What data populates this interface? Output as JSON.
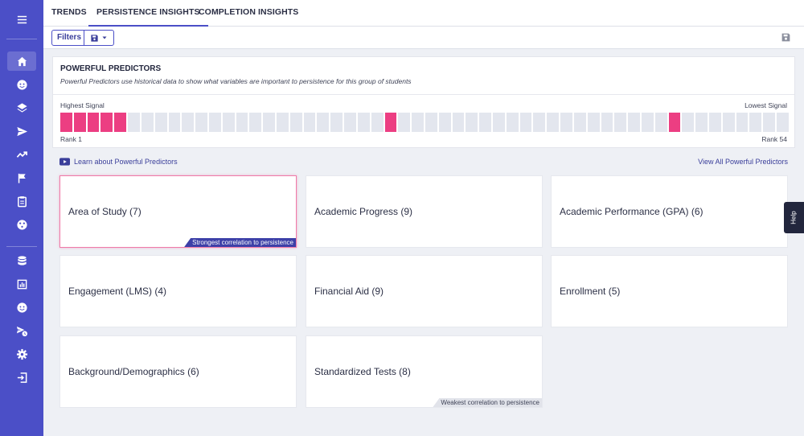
{
  "tabs": [
    "TRENDS",
    "PERSISTENCE INSIGHTS",
    "COMPLETION INSIGHTS"
  ],
  "toolbar": {
    "filters_label": "Filters"
  },
  "panel": {
    "title": "POWERFUL PREDICTORS",
    "description": "Powerful Predictors use historical data to show what variables are important to persistence for this group of students",
    "highest_label": "Highest Signal",
    "lowest_label": "Lowest Signal",
    "rank_first": "Rank 1",
    "rank_last": "Rank 54",
    "highlighted_ranks": [
      1,
      2,
      3,
      4,
      5,
      25,
      46
    ],
    "total_ranks": 54
  },
  "links": {
    "learn": "Learn about Powerful Predictors",
    "view_all": "View All Powerful Predictors"
  },
  "cards": [
    {
      "label": "Area of Study (7)",
      "tag": "Strongest correlation to persistence"
    },
    {
      "label": "Academic Progress (9)"
    },
    {
      "label": "Academic Performance (GPA) (6)"
    },
    {
      "label": "Engagement (LMS) (4)"
    },
    {
      "label": "Financial Aid (9)"
    },
    {
      "label": "Enrollment (5)"
    },
    {
      "label": "Background/Demographics (6)"
    },
    {
      "label": "Standardized Tests (8)",
      "tag": "Weakest correlation to persistence"
    }
  ],
  "help_label": "Help",
  "colors": {
    "accent": "#4b4fc7",
    "highlight": "#ec3e82",
    "sidebar": "#4b4fc7"
  }
}
